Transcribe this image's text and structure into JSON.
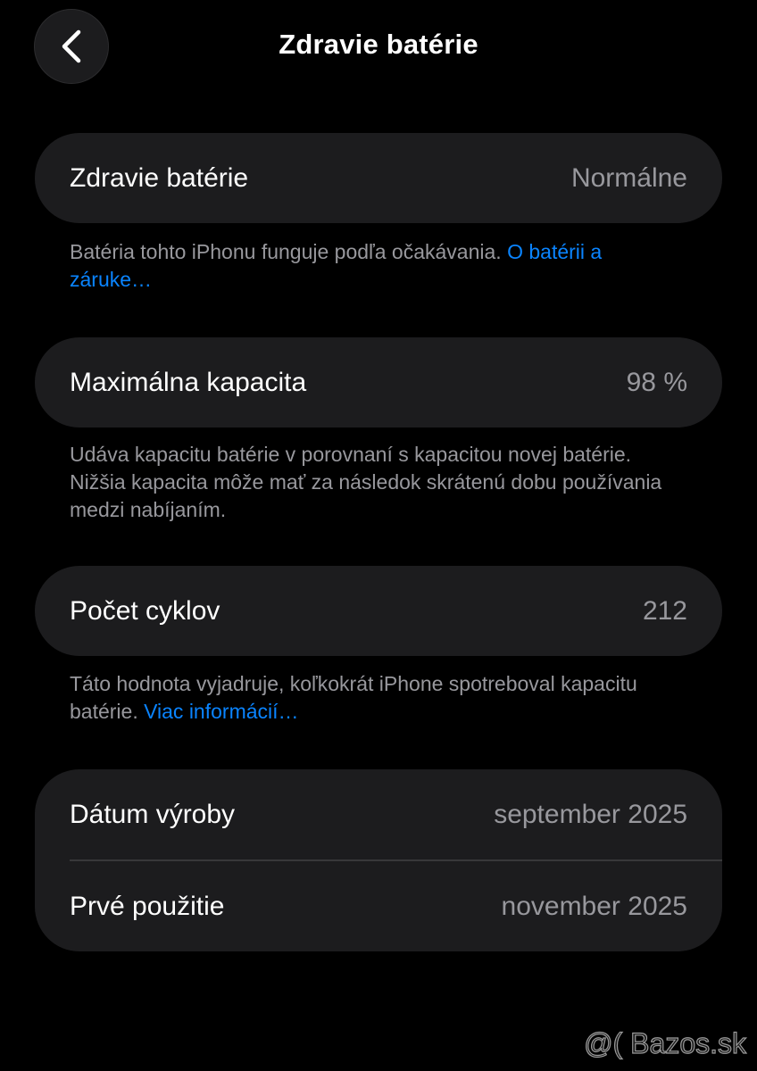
{
  "header": {
    "title": "Zdravie batérie",
    "back_icon": "chevron-left-icon"
  },
  "health": {
    "label": "Zdravie batérie",
    "value": "Normálne",
    "footnote_text": "Batéria tohto iPhonu funguje podľa očakávania. ",
    "footnote_link": "O batérii a záruke…"
  },
  "capacity": {
    "label": "Maximálna kapacita",
    "value": "98 %",
    "footnote_text": "Udáva kapacitu batérie v porovnaní s kapacitou novej batérie. Nižšia kapacita môže mať za následok skrátenú dobu používania medzi nabíjaním."
  },
  "cycles": {
    "label": "Počet cyklov",
    "value": "212",
    "footnote_text": "Táto hodnota vyjadruje, koľkokrát iPhone spotreboval kapacitu batérie. ",
    "footnote_link": "Viac informácií…"
  },
  "dates": {
    "manufacture_label": "Dátum výroby",
    "manufacture_value": "september 2025",
    "first_use_label": "Prvé použitie",
    "first_use_value": "november 2025"
  },
  "watermark": "@( Bazos.sk",
  "colors": {
    "background": "#000000",
    "card": "#1c1c1e",
    "secondary_text": "#98989d",
    "link": "#0a84ff"
  }
}
